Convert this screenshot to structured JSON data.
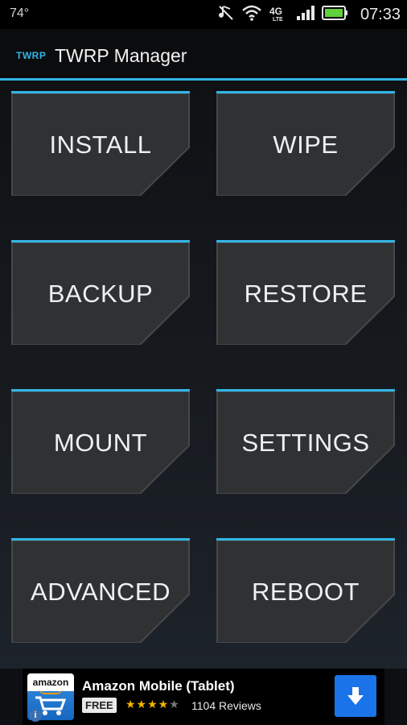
{
  "status_bar": {
    "temperature": "74°",
    "time": "07:33"
  },
  "app_bar": {
    "logo_text": "TWRP",
    "title": "TWRP Manager"
  },
  "tiles": [
    {
      "label": "INSTALL"
    },
    {
      "label": "WIPE"
    },
    {
      "label": "BACKUP"
    },
    {
      "label": "RESTORE"
    },
    {
      "label": "MOUNT"
    },
    {
      "label": "SETTINGS"
    },
    {
      "label": "ADVANCED"
    },
    {
      "label": "REBOOT"
    }
  ],
  "ad": {
    "logo_text": "amazon",
    "title": "Amazon Mobile (Tablet)",
    "badge": "FREE",
    "rating": "4 of 5 stars",
    "reviews": "1104 Reviews"
  },
  "colors": {
    "accent": "#33b5e5",
    "tile": "#2f3133",
    "ad_button": "#1a73e8"
  }
}
